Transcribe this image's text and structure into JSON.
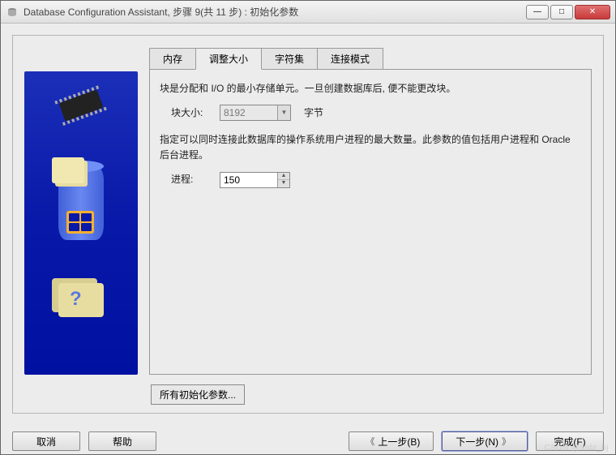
{
  "window": {
    "title": "Database Configuration Assistant, 步骤 9(共 11 步) : 初始化参数"
  },
  "tabs": {
    "items": [
      {
        "label": "内存"
      },
      {
        "label": "调整大小"
      },
      {
        "label": "字符集"
      },
      {
        "label": "连接模式"
      }
    ],
    "active_index": 1
  },
  "panel": {
    "block_desc": "块是分配和 I/O 的最小存储单元。一旦创建数据库后, 便不能更改块。",
    "block_size_label": "块大小:",
    "block_size_value": "8192",
    "block_size_unit": "字节",
    "process_desc": "指定可以同时连接此数据库的操作系统用户进程的最大数量。此参数的值包括用户进程和 Oracle 后台进程。",
    "process_label": "进程:",
    "process_value": "150"
  },
  "buttons": {
    "all_params": "所有初始化参数...",
    "cancel": "取消",
    "help": "帮助",
    "back": "上一步(B)",
    "next": "下一步(N)",
    "finish": "完成(F)"
  },
  "icons": {
    "back_arrow": "《",
    "next_arrow": "》",
    "checkmark": "✓"
  },
  "watermark": "CSDN @lhdz_bj"
}
